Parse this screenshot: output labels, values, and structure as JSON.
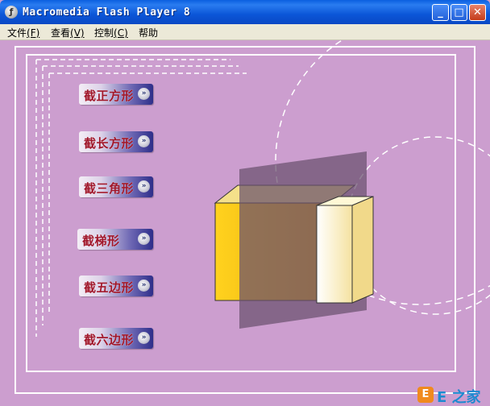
{
  "window": {
    "title": "Macromedia Flash Player 8",
    "app_icon": "flash-icon",
    "app_icon_glyph": "ƒ",
    "minimize_glyph": "_",
    "maximize_glyph": "□",
    "close_glyph": "✕"
  },
  "menu": {
    "items": [
      {
        "label": "文件",
        "key": "(F)"
      },
      {
        "label": "查看",
        "key": "(V)"
      },
      {
        "label": "控制",
        "key": "(C)"
      },
      {
        "label": "帮助",
        "key": ""
      }
    ]
  },
  "nav": {
    "arrow_glyph": "»",
    "buttons": [
      {
        "label": "截正方形"
      },
      {
        "label": "截长方形"
      },
      {
        "label": "截三角形"
      },
      {
        "label": "截梯形"
      },
      {
        "label": "截五边形"
      },
      {
        "label": "截六边形"
      }
    ]
  },
  "watermark": {
    "logo": "E",
    "text": "E 之家"
  },
  "colors": {
    "stage_bg": "#cc9ecf",
    "titlebar": "#0a5fe0",
    "button_text": "#a0162a"
  }
}
